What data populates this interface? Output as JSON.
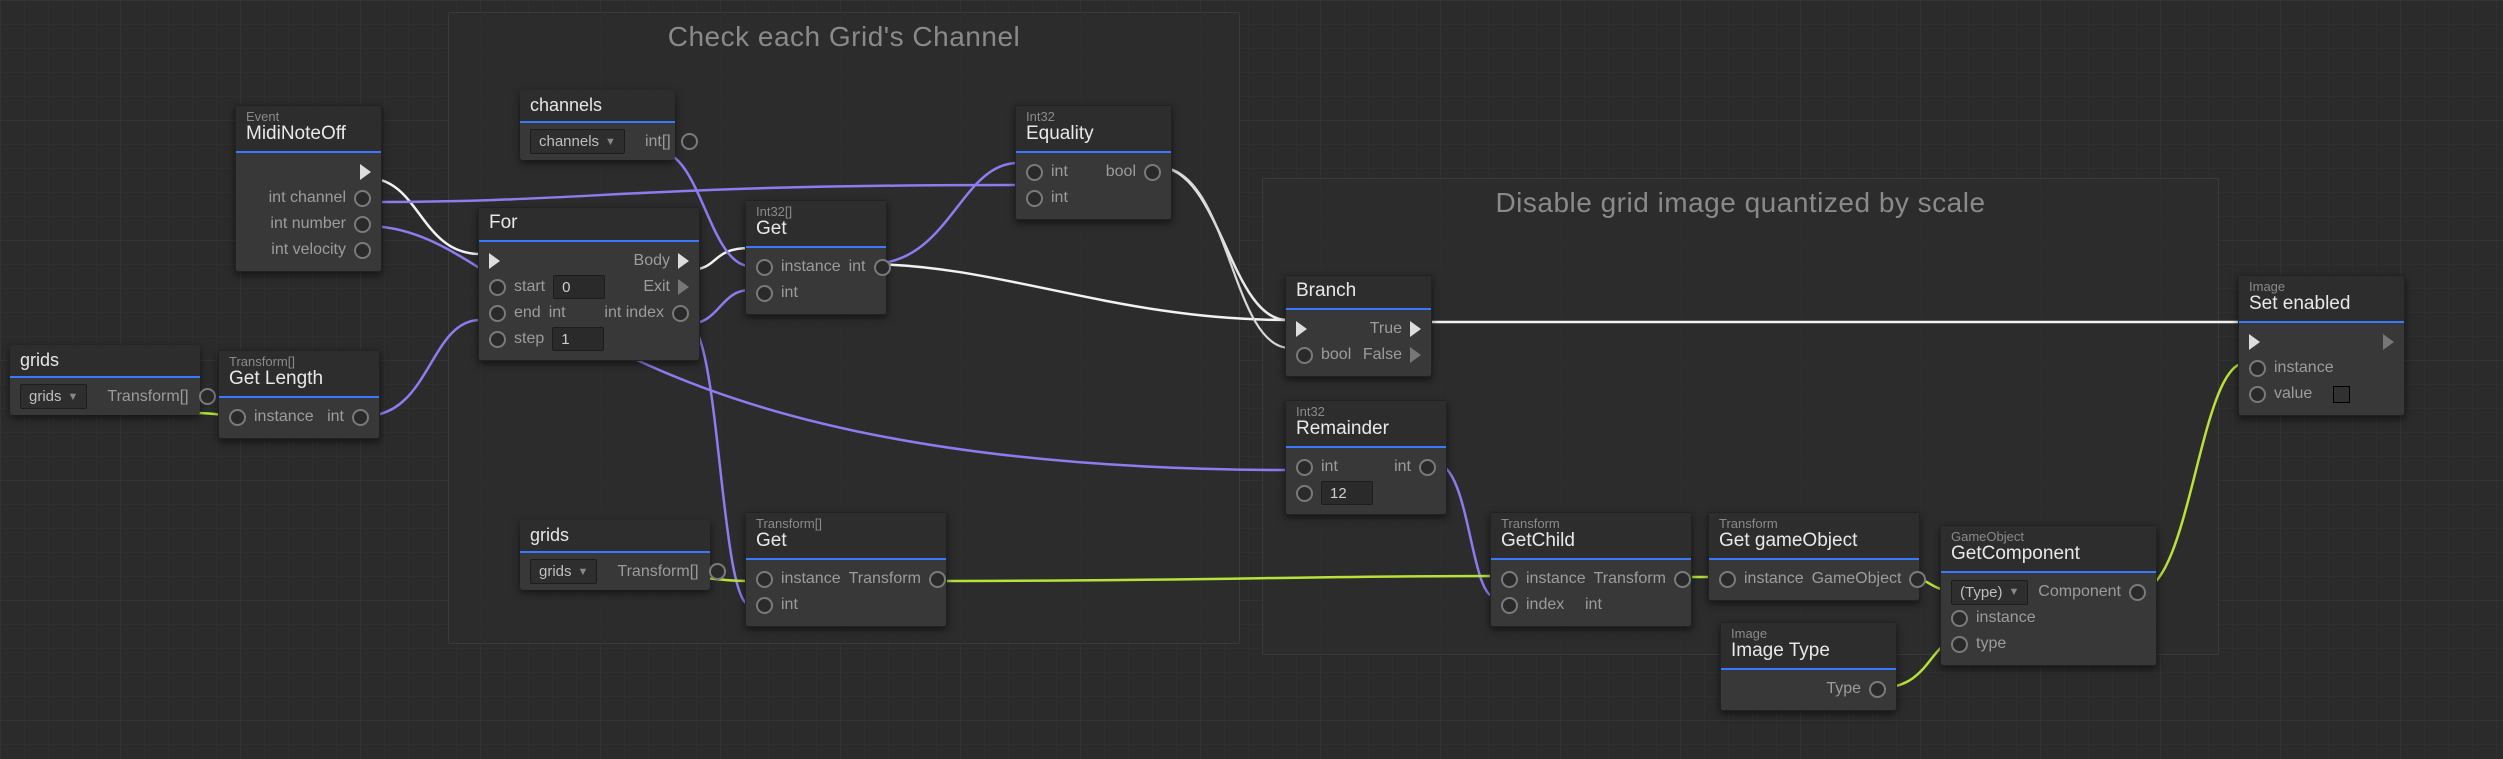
{
  "groups": {
    "g1": {
      "title": "Check each Grid's Channel"
    },
    "g2": {
      "title": "Disable grid image quantized by scale"
    }
  },
  "nodes": {
    "midi": {
      "sub": "Event",
      "title": "MidiNoteOff",
      "p_channel": "int channel",
      "p_number": "int number",
      "p_velocity": "int velocity"
    },
    "gridsVar": {
      "title": "grids",
      "drop": "grids",
      "outType": "Transform[]"
    },
    "getLength": {
      "sub": "Transform[]",
      "title": "Get Length",
      "p_in": "instance",
      "p_out": "int"
    },
    "channelsVar": {
      "title": "channels",
      "drop": "channels",
      "outType": "int[]"
    },
    "forNode": {
      "title": "For",
      "p_start": "start",
      "v_start": "0",
      "p_end": "end",
      "t_end": "int",
      "p_step": "step",
      "v_step": "1",
      "o_body": "Body",
      "o_exit": "Exit",
      "o_index": "int index"
    },
    "getInt": {
      "sub": "Int32[]",
      "title": "Get",
      "p_inst": "instance",
      "p_int": "int",
      "o_int": "int"
    },
    "equality": {
      "sub": "Int32",
      "title": "Equality",
      "p_a": "int",
      "p_b": "int",
      "o": "bool"
    },
    "gridsVar2": {
      "title": "grids",
      "drop": "grids",
      "outType": "Transform[]"
    },
    "getTrans": {
      "sub": "Transform[]",
      "title": "Get",
      "p_inst": "instance",
      "p_int": "int",
      "o": "Transform"
    },
    "branch": {
      "title": "Branch",
      "p_bool": "bool",
      "o_true": "True",
      "o_false": "False"
    },
    "remainder": {
      "sub": "Int32",
      "title": "Remainder",
      "p_a": "int",
      "v_b": "12",
      "o": "int"
    },
    "getChild": {
      "sub": "Transform",
      "title": "GetChild",
      "p_inst": "instance",
      "p_idx": "index",
      "t_idx": "int",
      "o": "Transform"
    },
    "getGO": {
      "sub": "Transform",
      "title": "Get gameObject",
      "p_in": "instance",
      "o": "GameObject"
    },
    "imgType": {
      "sub": "Image",
      "title": "Image Type",
      "o": "Type"
    },
    "getComp": {
      "sub": "GameObject",
      "title": "GetComponent",
      "drop": "(Type)",
      "p_inst": "instance",
      "p_type": "type",
      "o": "Component"
    },
    "setEnabled": {
      "sub": "Image",
      "title": "Set enabled",
      "p_inst": "instance",
      "p_val": "value"
    }
  },
  "colors": {
    "flow": "#f2f2f2",
    "int": "#8d7cf0",
    "bool": "#d8d8d8",
    "obj": "#b6e23a"
  }
}
